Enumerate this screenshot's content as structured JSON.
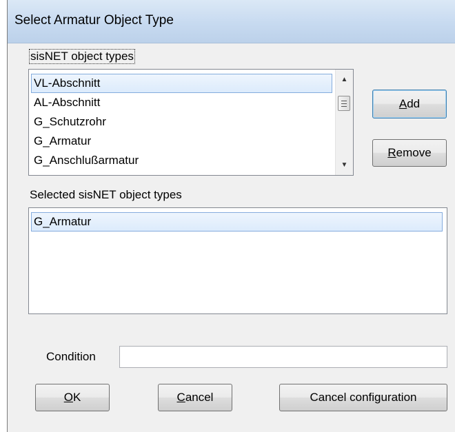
{
  "window": {
    "title": "Select Armatur Object Type"
  },
  "available": {
    "label": "sisNET object types",
    "items": [
      {
        "label": "VL-Abschnitt",
        "selected": true
      },
      {
        "label": "AL-Abschnitt",
        "selected": false
      },
      {
        "label": "G_Schutzrohr",
        "selected": false
      },
      {
        "label": "G_Armatur",
        "selected": false
      },
      {
        "label": "G_Anschlußarmatur",
        "selected": false
      }
    ]
  },
  "buttons": {
    "add": {
      "accel": "A",
      "rest": "dd"
    },
    "remove": {
      "accel": "R",
      "rest": "emove"
    },
    "ok": {
      "accel": "O",
      "rest": "K"
    },
    "cancel": {
      "accel": "C",
      "rest": "ancel"
    },
    "cancel_configuration": "Cancel configuration"
  },
  "selected": {
    "label": "Selected sisNET object types",
    "items": [
      {
        "label": "G_Armatur",
        "selected": true
      }
    ]
  },
  "condition": {
    "label": "Condition",
    "value": ""
  },
  "icons": {
    "scroll_up": "scroll-up-arrow-icon",
    "scroll_down": "scroll-down-arrow-icon"
  },
  "colors": {
    "selection_border": "#84acdd",
    "selection_fill": "#dcebfc",
    "dialog_bg": "#f0f0f0",
    "titlebar": "#c7daf0"
  }
}
